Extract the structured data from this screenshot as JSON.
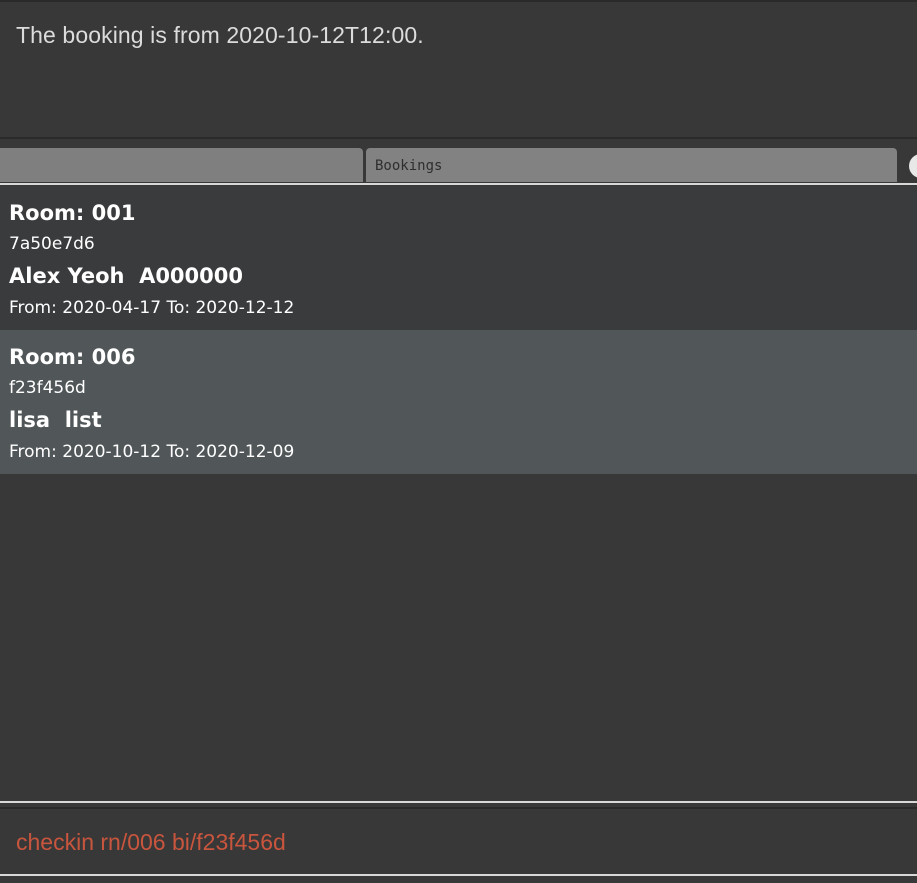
{
  "result_display": {
    "text": "The booking is from 2020-10-12T12:00."
  },
  "tabs": [
    {
      "label": ""
    },
    {
      "label": "Bookings"
    }
  ],
  "bookings": [
    {
      "room": "Room: 001",
      "booking_id": "7a50e7d6",
      "guest": "Alex Yeoh  A000000",
      "dates": "From: 2020-04-17 To: 2020-12-12"
    },
    {
      "room": "Room: 006",
      "booking_id": "f23f456d",
      "guest": "lisa  list",
      "dates": "From: 2020-10-12 To: 2020-12-09"
    }
  ],
  "command_box": {
    "value": "checkin rn/006 bi/f23f456d"
  },
  "colors": {
    "background": "#383838",
    "selected_card": "#515658",
    "command_text": "#c8553d"
  }
}
